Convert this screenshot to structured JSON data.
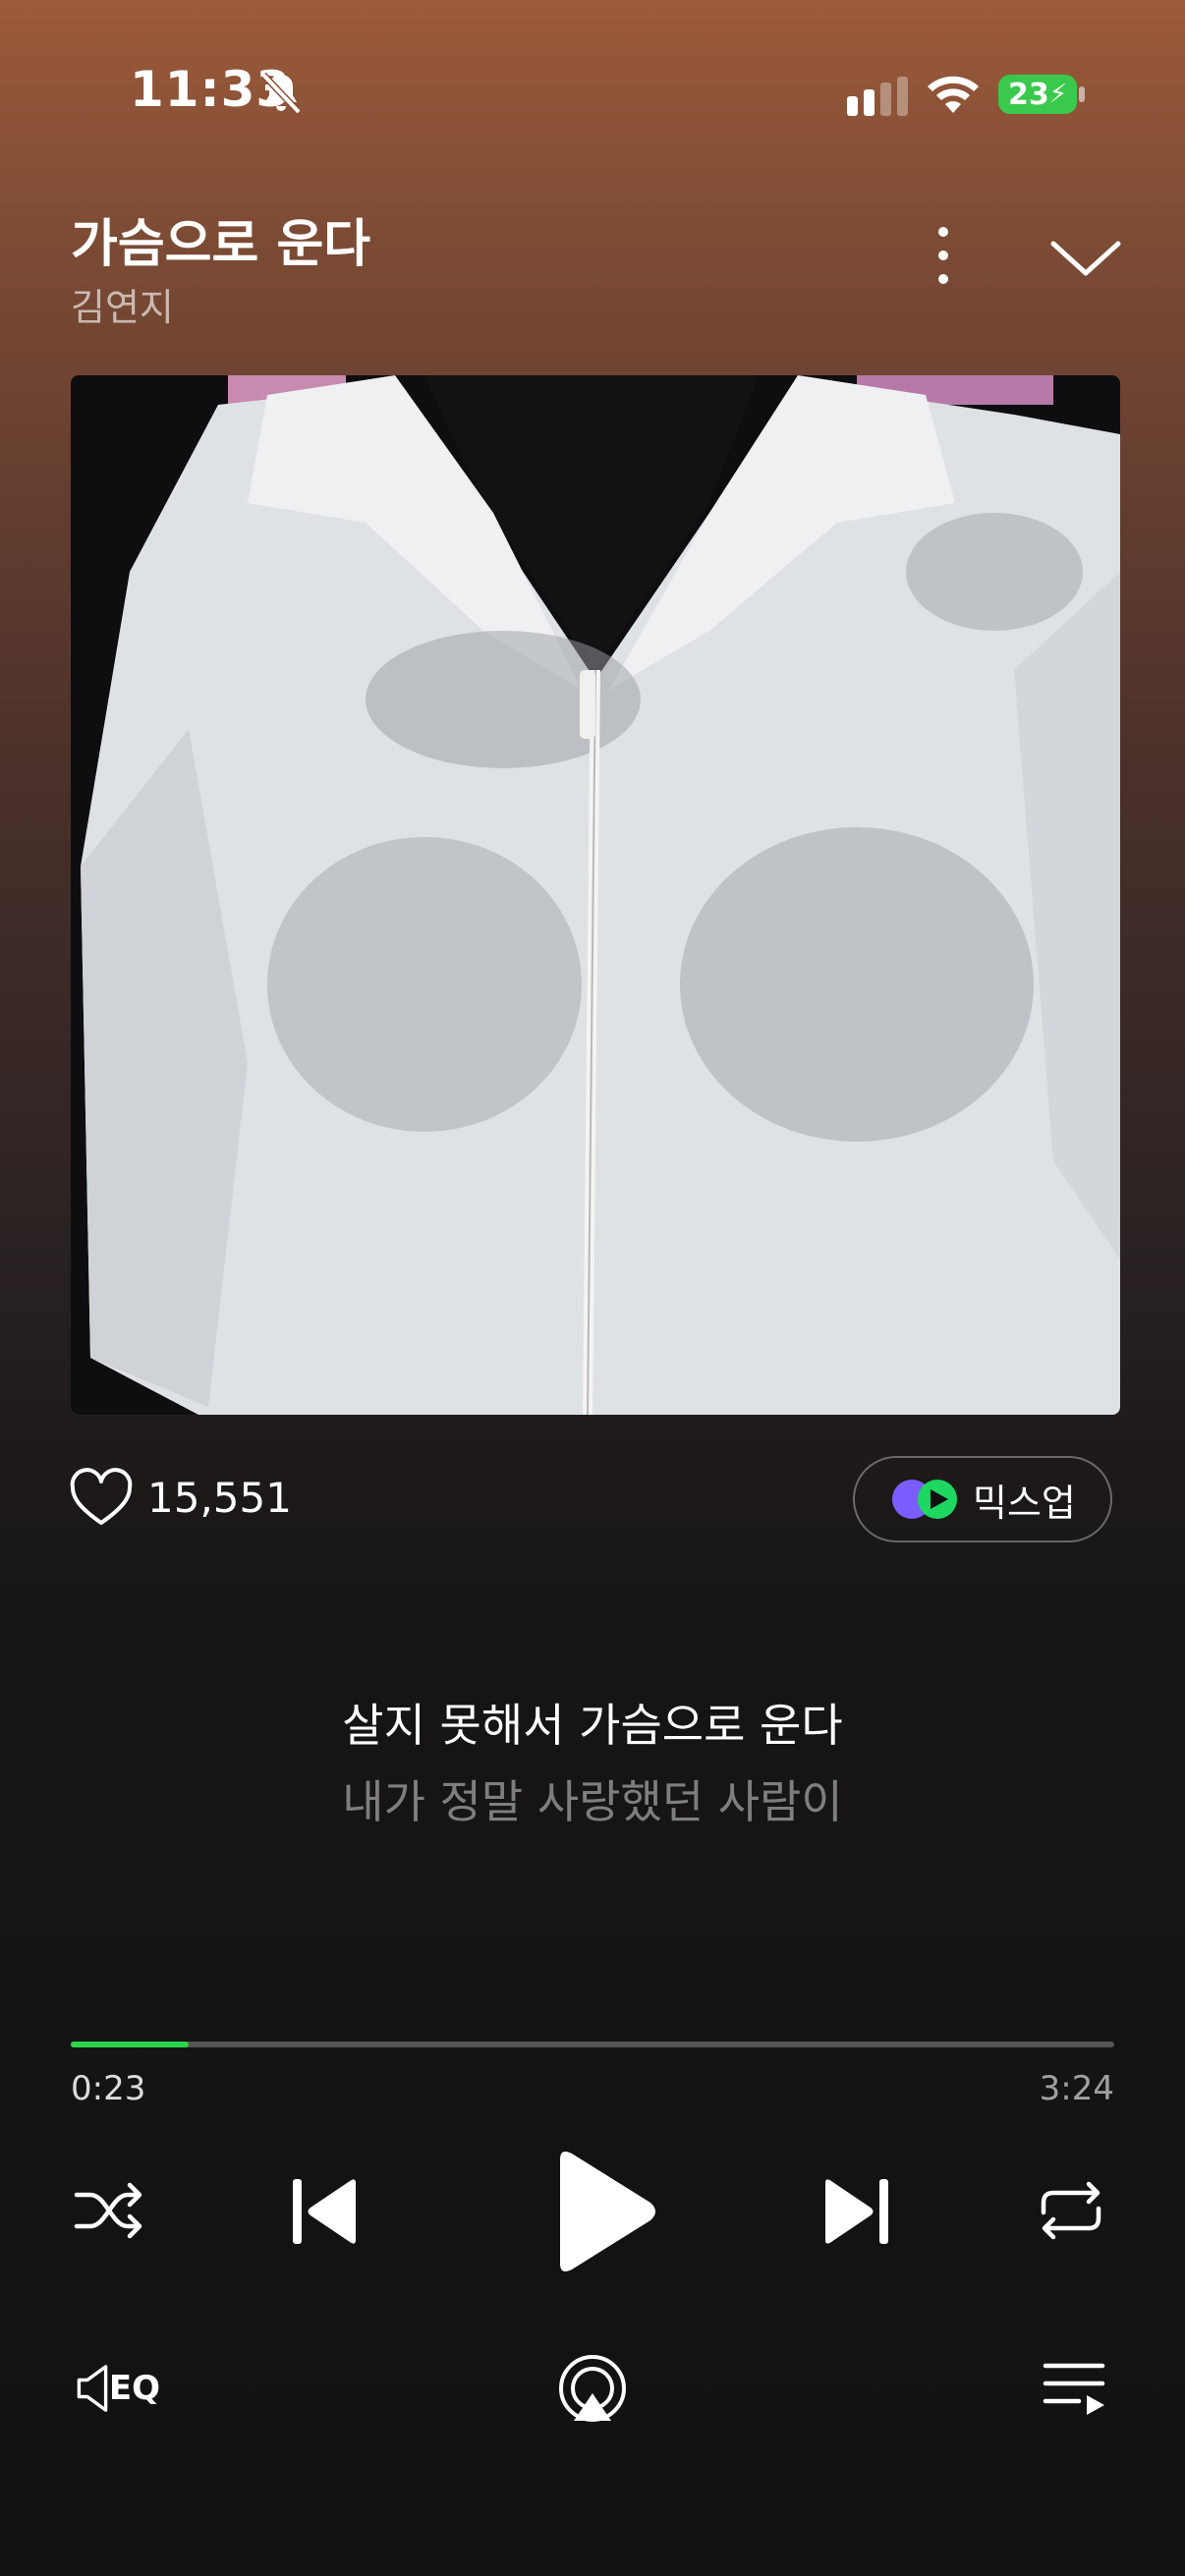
{
  "status_bar": {
    "time": "11:33",
    "battery": "23"
  },
  "player": {
    "title": "가슴으로 운다",
    "artist": "김연지",
    "likes": "15,551",
    "mixup_label": "믹스업",
    "lyrics": {
      "current": "살지 못해서 가슴으로 운다",
      "next": "내가 정말 사랑했던 사람이"
    },
    "time_current": "0:23",
    "time_total": "3:24",
    "progress_fraction": 0.113,
    "eq_label": "EQ"
  },
  "colors": {
    "accent": "#2bd44a",
    "battery": "#3ac94c"
  },
  "icons": [
    "bell-muted-icon",
    "cellular-signal-icon",
    "wifi-icon",
    "more-vertical-icon",
    "chevron-down-icon",
    "heart-icon",
    "mixup-logo-icon",
    "shuffle-icon",
    "previous-icon",
    "play-icon",
    "next-icon",
    "repeat-icon",
    "eq-icon",
    "airplay-icon",
    "queue-icon"
  ]
}
